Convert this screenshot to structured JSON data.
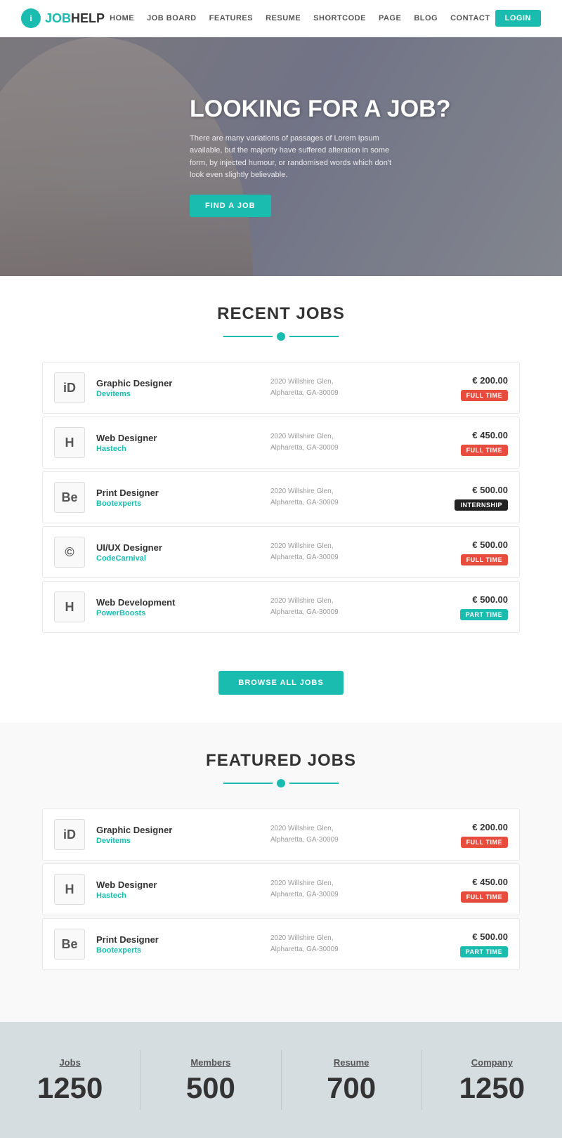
{
  "nav": {
    "logo_text_main": "JOB",
    "logo_text_accent": "HELP",
    "links": [
      "HOME",
      "JOB BOARD",
      "FEATURES",
      "RESUME",
      "SHORTCODE",
      "PAGE",
      "BLOG",
      "CONTACT"
    ],
    "login_label": "LOGIN"
  },
  "hero": {
    "title": "LOOKING FOR A JOB?",
    "subtitle": "There are many variations of passages of Lorem Ipsum available, but the majority have suffered alteration in some form, by injected humour, or randomised words which don't look even slightly believable.",
    "cta_label": "FIND A JOB"
  },
  "recent_jobs": {
    "section_title": "RECENT JOBS",
    "jobs": [
      {
        "icon": "iD",
        "title": "Graphic Designer",
        "company": "Devitems",
        "location": "2020 Willshire Glen, Alpharetta, GA-30009",
        "salary": "€ 200.00",
        "badge": "FULL TIME",
        "badge_type": "fulltime"
      },
      {
        "icon": "H",
        "title": "Web Designer",
        "company": "Hastech",
        "location": "2020 Willshire Glen, Alpharetta, GA-30009",
        "salary": "€ 450.00",
        "badge": "FULL TIME",
        "badge_type": "fulltime"
      },
      {
        "icon": "Be",
        "title": "Print Designer",
        "company": "Bootexperts",
        "location": "2020 Willshire Glen, Alpharetta, GA-30009",
        "salary": "€ 500.00",
        "badge": "INTERNSHIP",
        "badge_type": "internship"
      },
      {
        "icon": "©",
        "title": "UI/UX Designer",
        "company": "CodeCarnival",
        "location": "2020 Willshire Glen, Alpharetta, GA-30009",
        "salary": "€ 500.00",
        "badge": "FULL TIME",
        "badge_type": "fulltime"
      },
      {
        "icon": "H",
        "title": "Web Development",
        "company": "PowerBoosts",
        "location": "2020 Willshire Glen, Alpharetta, GA-30009",
        "salary": "€ 500.00",
        "badge": "PART TIME",
        "badge_type": "parttime"
      }
    ],
    "browse_label": "BROWSE ALL JOBS"
  },
  "featured_jobs": {
    "section_title": "FEATURED JOBS",
    "jobs": [
      {
        "icon": "iD",
        "title": "Graphic Designer",
        "company": "Devitems",
        "location": "2020 Willshire Glen, Alpharetta, GA-30009",
        "salary": "€ 200.00",
        "badge": "FULL TIME",
        "badge_type": "fulltime"
      },
      {
        "icon": "H",
        "title": "Web Designer",
        "company": "Hastech",
        "location": "2020 Willshire Glen, Alpharetta, GA-30009",
        "salary": "€ 450.00",
        "badge": "FULL TIME",
        "badge_type": "fulltime"
      },
      {
        "icon": "Be",
        "title": "Print Designer",
        "company": "Bootexperts",
        "location": "2020 Willshire Glen, Alpharetta, GA-30009",
        "salary": "€ 500.00",
        "badge": "PART TIME",
        "badge_type": "parttime"
      }
    ]
  },
  "stats": [
    {
      "label": "Jobs",
      "value": "1250"
    },
    {
      "label": "Members",
      "value": "500"
    },
    {
      "label": "Resume",
      "value": "700"
    },
    {
      "label": "Company",
      "value": "1250"
    }
  ]
}
